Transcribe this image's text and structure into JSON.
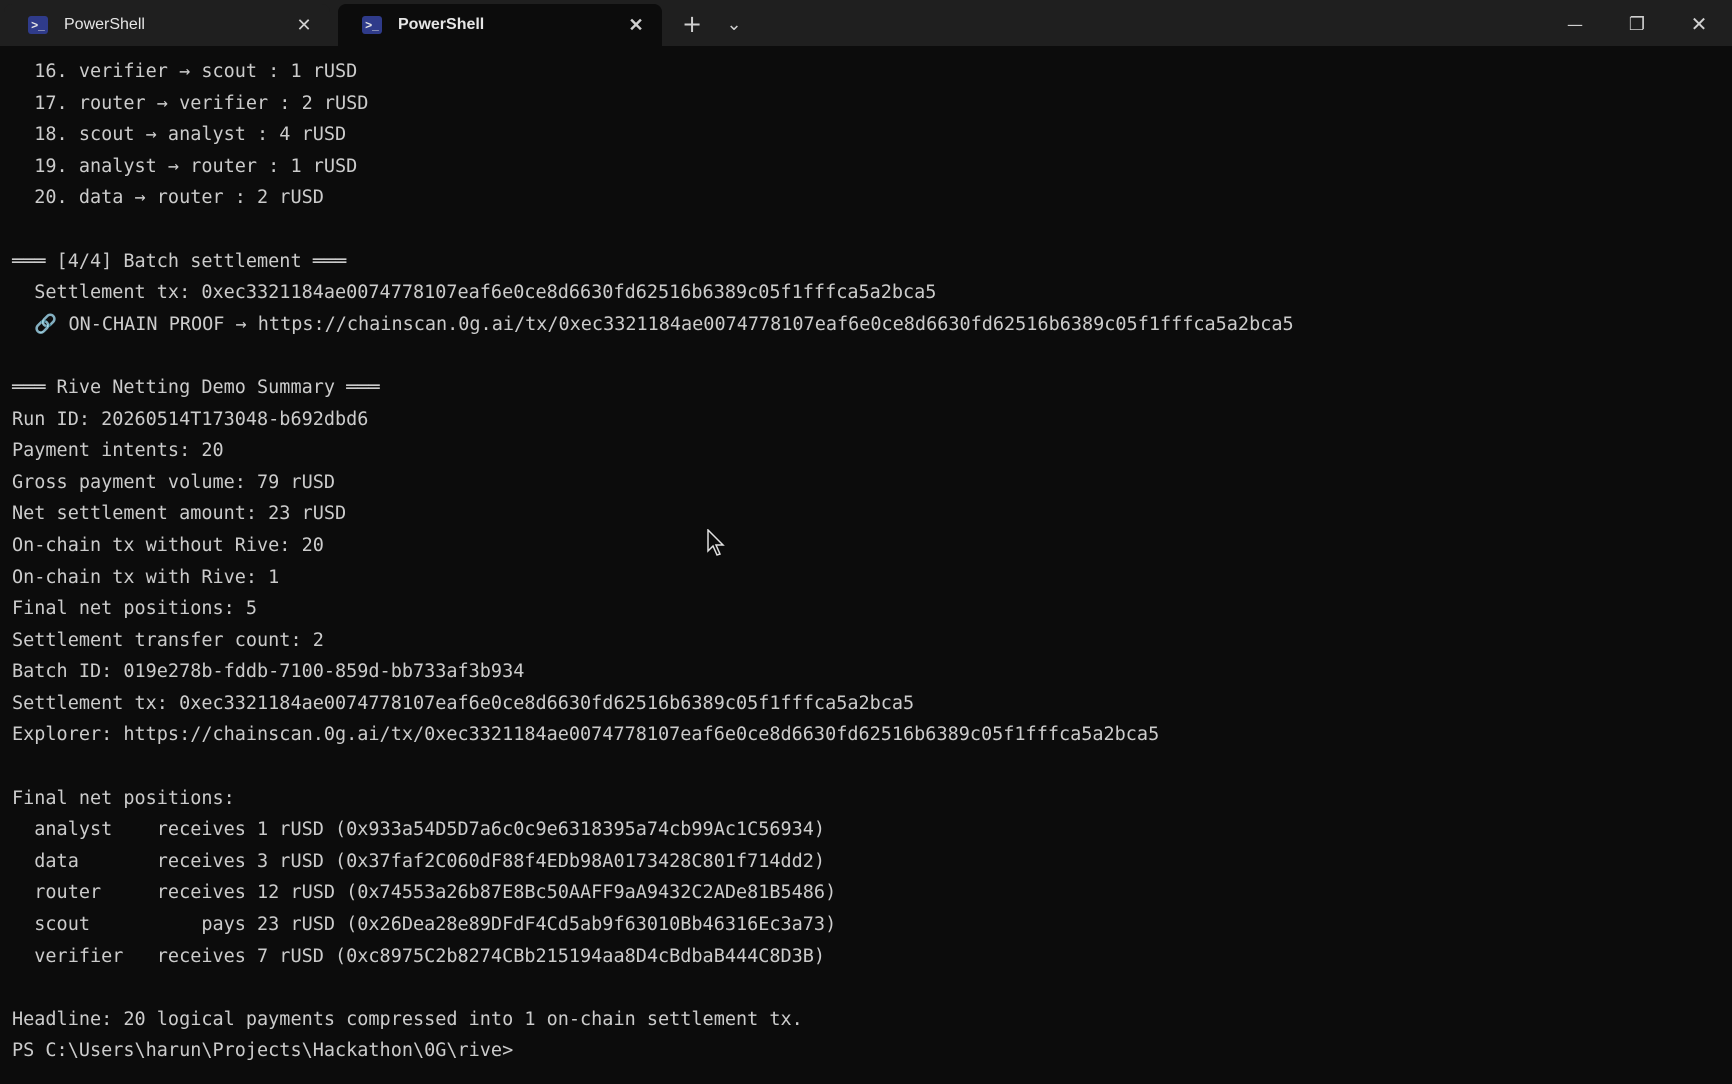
{
  "window": {
    "tabs": [
      {
        "label": "PowerShell",
        "icon": "powershell-icon",
        "active": false
      },
      {
        "label": "PowerShell",
        "icon": "powershell-icon",
        "active": true
      }
    ],
    "new_tab_glyph": "+",
    "dropdown_glyph": "⌄",
    "minimize_glyph": "—",
    "restore_glyph": "❐",
    "close_glyph": "✕",
    "tab_close_glyph": "✕"
  },
  "terminal": {
    "lines": [
      "  16. verifier → scout : 1 rUSD",
      "  17. router → verifier : 2 rUSD",
      "  18. scout → analyst : 4 rUSD",
      "  19. analyst → router : 1 rUSD",
      "  20. data → router : 2 rUSD",
      "",
      "═══ [4/4] Batch settlement ═══",
      "  Settlement tx: 0xec3321184ae0074778107eaf6e0ce8d6630fd62516b6389c05f1fffca5a2bca5",
      "  🔗 ON-CHAIN PROOF → https://chainscan.0g.ai/tx/0xec3321184ae0074778107eaf6e0ce8d6630fd62516b6389c05f1fffca5a2bca5",
      "",
      "═══ Rive Netting Demo Summary ═══",
      "Run ID: 20260514T173048-b692dbd6",
      "Payment intents: 20",
      "Gross payment volume: 79 rUSD",
      "Net settlement amount: 23 rUSD",
      "On-chain tx without Rive: 20",
      "On-chain tx with Rive: 1",
      "Final net positions: 5",
      "Settlement transfer count: 2",
      "Batch ID: 019e278b-fddb-7100-859d-bb733af3b934",
      "Settlement tx: 0xec3321184ae0074778107eaf6e0ce8d6630fd62516b6389c05f1fffca5a2bca5",
      "Explorer: https://chainscan.0g.ai/tx/0xec3321184ae0074778107eaf6e0ce8d6630fd62516b6389c05f1fffca5a2bca5",
      "",
      "Final net positions:",
      "  analyst    receives 1 rUSD (0x933a54D5D7a6c0c9e6318395a74cb99Ac1C56934)",
      "  data       receives 3 rUSD (0x37faf2C060dF88f4EDb98A0173428C801f714dd2)",
      "  router     receives 12 rUSD (0x74553a26b87E8Bc50AAFF9aA9432C2ADe81B5486)",
      "  scout          pays 23 rUSD (0x26Dea28e89DFdF4Cd5ab9f63010Bb46316Ec3a73)",
      "  verifier   receives 7 rUSD (0xc8975C2b8274CBb215194aa8D4cBdbaB444C8D3B)",
      "",
      "Headline: 20 logical payments compressed into 1 on-chain settlement tx.",
      "PS C:\\Users\\harun\\Projects\\Hackathon\\0G\\rive>"
    ]
  }
}
